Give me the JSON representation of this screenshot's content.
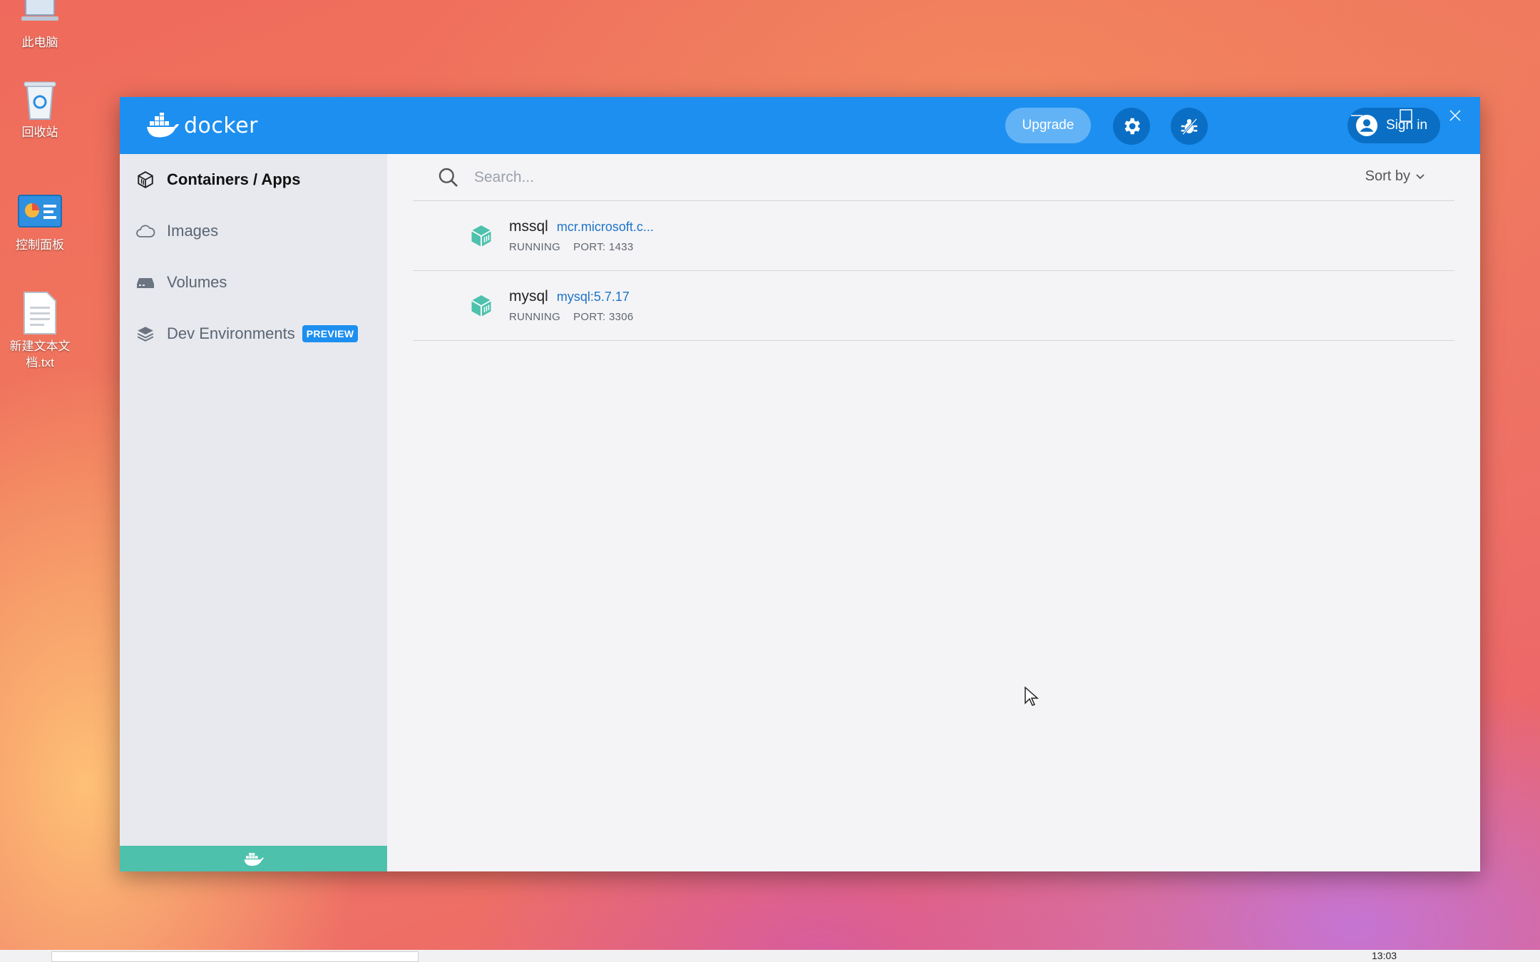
{
  "desktop": {
    "icons": [
      {
        "label": "此电脑"
      },
      {
        "label": "回收站"
      },
      {
        "label": "控制面板"
      },
      {
        "label": "新建文本文\n档.txt"
      }
    ]
  },
  "window": {
    "logo_text": "docker",
    "upgrade_label": "Upgrade",
    "signin_label": "Sign in"
  },
  "sidebar": {
    "items": [
      {
        "label": "Containers / Apps",
        "icon": "container-box-icon",
        "active": true
      },
      {
        "label": "Images",
        "icon": "cloud-icon"
      },
      {
        "label": "Volumes",
        "icon": "disk-icon"
      },
      {
        "label": "Dev Environments",
        "icon": "layers-icon",
        "badge": "PREVIEW"
      }
    ],
    "footer_color": "#4ec1ad"
  },
  "main": {
    "search_placeholder": "Search...",
    "sort_label": "Sort by",
    "containers": [
      {
        "name": "mssql",
        "image": "mcr.microsoft.c...",
        "status": "RUNNING",
        "port": "PORT: 1433"
      },
      {
        "name": "mysql",
        "image": "mysql:5.7.17",
        "status": "RUNNING",
        "port": "PORT: 3306"
      }
    ]
  },
  "taskbar": {
    "clock": "13:03"
  },
  "colors": {
    "brand": "#1d8ff0",
    "running": "#4ec1ad",
    "link": "#1d72c9"
  }
}
